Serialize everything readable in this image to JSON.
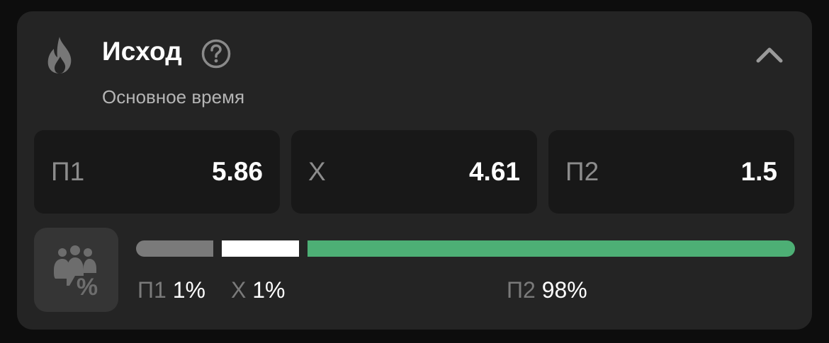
{
  "header": {
    "title": "Исход",
    "subtitle": "Основное время",
    "icons": [
      "fire-icon",
      "help-icon",
      "chevron-up-icon"
    ]
  },
  "odds": [
    {
      "label": "П1",
      "value": "5.86"
    },
    {
      "label": "Х",
      "value": "4.61"
    },
    {
      "label": "П2",
      "value": "1.5"
    }
  ],
  "stats": {
    "icon": "people-percent-icon",
    "items": [
      {
        "label": "П1",
        "percent": "1%",
        "share": 0.01,
        "color": "#7a7a7a"
      },
      {
        "label": "Х",
        "percent": "1%",
        "share": 0.01,
        "color": "#ffffff"
      },
      {
        "label": "П2",
        "percent": "98%",
        "share": 0.98,
        "color": "#4daf75"
      }
    ]
  },
  "colors": {
    "background": "#0d0d0d",
    "card": "#242424",
    "odd_tile": "#181818",
    "accent_green": "#4daf75"
  }
}
